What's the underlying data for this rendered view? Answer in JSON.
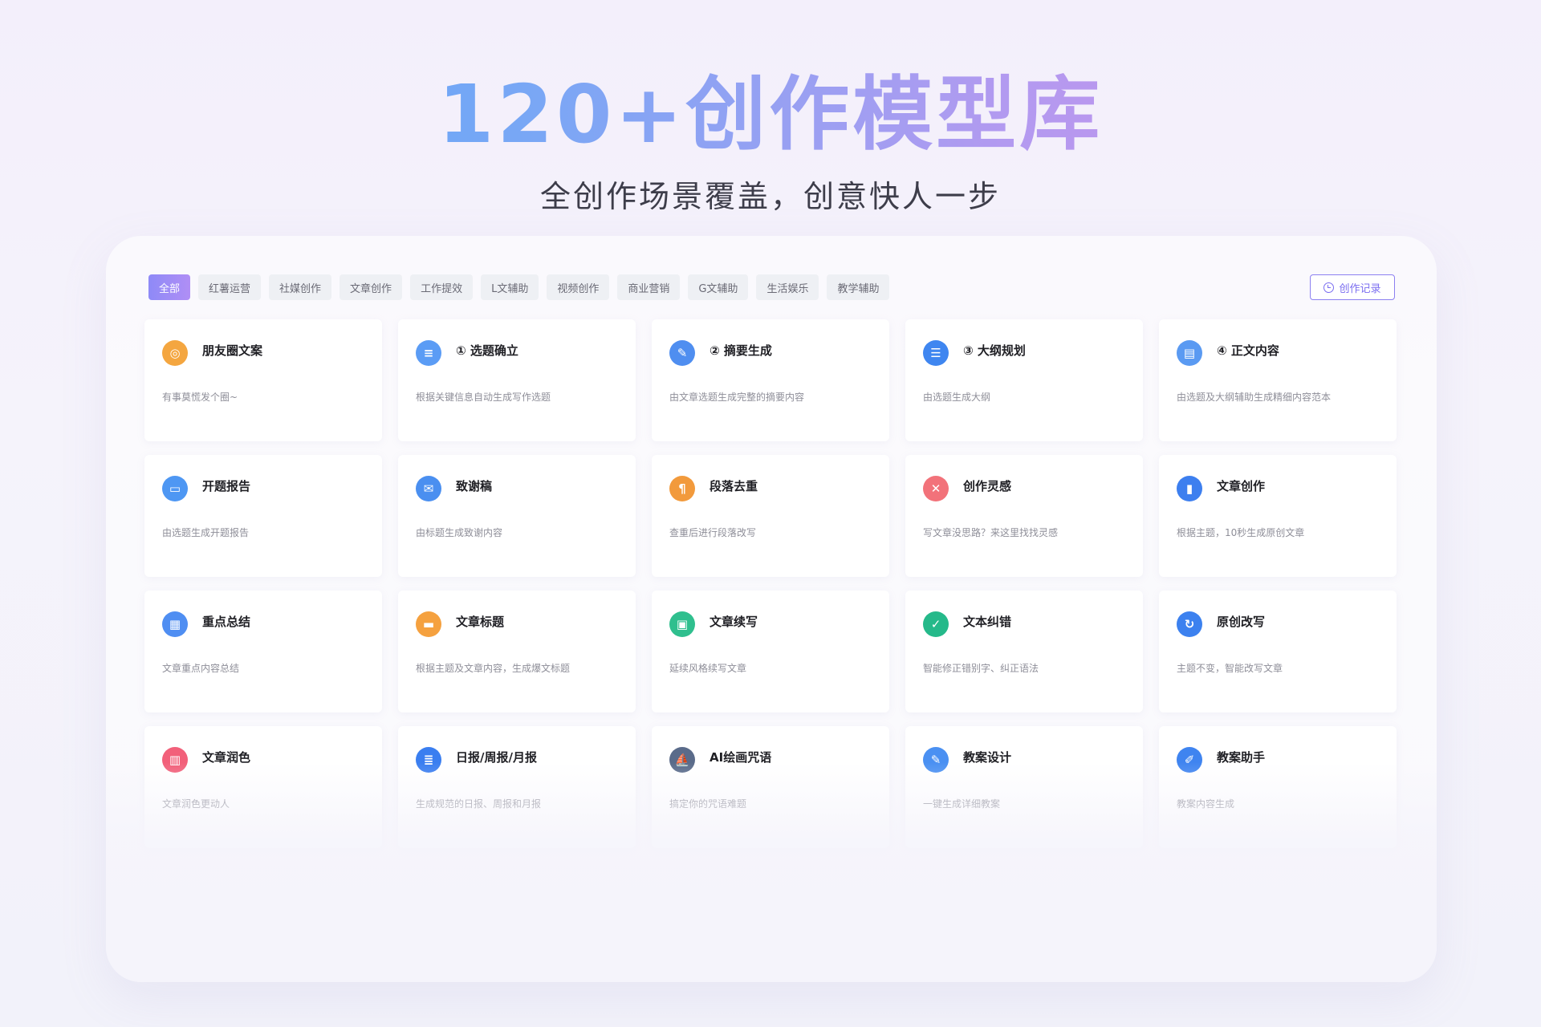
{
  "hero": {
    "title": "120+创作模型库",
    "subtitle": "全创作场景覆盖，创意快人一步"
  },
  "tabs": [
    {
      "label": "全部",
      "active": true
    },
    {
      "label": "红薯运营",
      "active": false
    },
    {
      "label": "社媒创作",
      "active": false
    },
    {
      "label": "文章创作",
      "active": false
    },
    {
      "label": "工作提效",
      "active": false
    },
    {
      "label": "L文辅助",
      "active": false
    },
    {
      "label": "视频创作",
      "active": false
    },
    {
      "label": "商业营销",
      "active": false
    },
    {
      "label": "G文辅助",
      "active": false
    },
    {
      "label": "生活娱乐",
      "active": false
    },
    {
      "label": "教学辅助",
      "active": false
    }
  ],
  "history_button": {
    "label": "创作记录",
    "icon": "clock-icon"
  },
  "cards": [
    {
      "title": "朋友圈文案",
      "desc": "有事莫慌发个圈~",
      "icon": "ring-icon",
      "color": "#f4a640",
      "glyph": "◎"
    },
    {
      "title": "① 选题确立",
      "desc": "根据关键信息自动生成写作选题",
      "icon": "document-list-icon",
      "color": "#5b9cf5",
      "glyph": "≡"
    },
    {
      "title": "② 摘要生成",
      "desc": "由文章选题生成完整的摘要内容",
      "icon": "document-edit-icon",
      "color": "#4f8ef0",
      "glyph": "✎"
    },
    {
      "title": "③ 大纲规划",
      "desc": "由选题生成大纲",
      "icon": "outline-icon",
      "color": "#3f86f0",
      "glyph": "☰"
    },
    {
      "title": "④ 正文内容",
      "desc": "由选题及大纲辅助生成精细内容范本",
      "icon": "content-icon",
      "color": "#5a9af2",
      "glyph": "▤"
    },
    {
      "title": "开题报告",
      "desc": "由选题生成开题报告",
      "icon": "report-icon",
      "color": "#4e97f3",
      "glyph": "▭"
    },
    {
      "title": "致谢稿",
      "desc": "由标题生成致谢内容",
      "icon": "thanks-icon",
      "color": "#4a8ff0",
      "glyph": "✉"
    },
    {
      "title": "段落去重",
      "desc": "查重后进行段落改写",
      "icon": "paragraph-icon",
      "color": "#f29a3c",
      "glyph": "¶"
    },
    {
      "title": "创作灵感",
      "desc": "写文章没思路？来这里找找灵感",
      "icon": "inspiration-icon",
      "color": "#f2727a",
      "glyph": "✕"
    },
    {
      "title": "文章创作",
      "desc": "根据主题，10秒生成原创文章",
      "icon": "article-icon",
      "color": "#3d7fef",
      "glyph": "▮"
    },
    {
      "title": "重点总结",
      "desc": "文章重点内容总结",
      "icon": "summary-icon",
      "color": "#4f8ef2",
      "glyph": "▦"
    },
    {
      "title": "文章标题",
      "desc": "根据主题及文章内容，生成爆文标题",
      "icon": "headline-icon",
      "color": "#f5a13f",
      "glyph": "▬"
    },
    {
      "title": "文章续写",
      "desc": "延续风格续写文章",
      "icon": "continue-icon",
      "color": "#2fbf8e",
      "glyph": "▣"
    },
    {
      "title": "文本纠错",
      "desc": "智能修正错别字、纠正语法",
      "icon": "check-icon",
      "color": "#25b98a",
      "glyph": "✓"
    },
    {
      "title": "原创改写",
      "desc": "主题不变，智能改写文章",
      "icon": "rewrite-icon",
      "color": "#3c81ef",
      "glyph": "↻"
    },
    {
      "title": "文章润色",
      "desc": "文章润色更动人",
      "icon": "polish-icon",
      "color": "#f2607a",
      "glyph": "▥"
    },
    {
      "title": "日报/周报/月报",
      "desc": "生成规范的日报、周报和月报",
      "icon": "daily-report-icon",
      "color": "#3a7ef0",
      "glyph": "≣"
    },
    {
      "title": "AI绘画咒语",
      "desc": "搞定你的咒语难题",
      "icon": "sailboat-icon",
      "color": "#5a6b8a",
      "glyph": "⛵"
    },
    {
      "title": "教案设计",
      "desc": "一键生成详细教案",
      "icon": "lesson-design-icon",
      "color": "#4a90f2",
      "glyph": "✎"
    },
    {
      "title": "教案助手",
      "desc": "教案内容生成",
      "icon": "lesson-assistant-icon",
      "color": "#3f84f0",
      "glyph": "✐"
    }
  ]
}
